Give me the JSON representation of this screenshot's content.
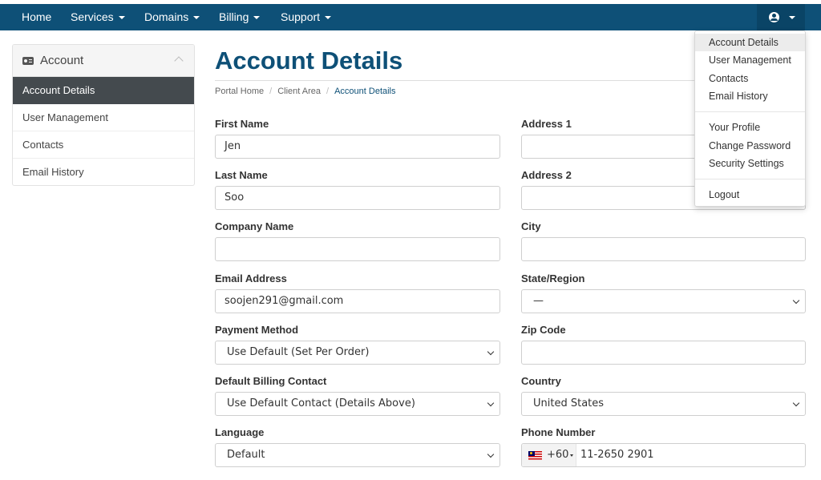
{
  "nav": {
    "home": "Home",
    "services": "Services",
    "domains": "Domains",
    "billing": "Billing",
    "support": "Support"
  },
  "sidebar": {
    "title": "Account",
    "items": [
      {
        "label": "Account Details"
      },
      {
        "label": "User Management"
      },
      {
        "label": "Contacts"
      },
      {
        "label": "Email History"
      }
    ]
  },
  "main": {
    "title": "Account Details",
    "breadcrumb": [
      "Portal Home",
      "Client Area",
      "Account Details"
    ]
  },
  "form": {
    "first_name": {
      "label": "First Name",
      "value": "Jen"
    },
    "last_name": {
      "label": "Last Name",
      "value": "Soo"
    },
    "company_name": {
      "label": "Company Name",
      "value": ""
    },
    "email": {
      "label": "Email Address",
      "value": "soojen291@gmail.com"
    },
    "payment_method": {
      "label": "Payment Method",
      "value": "Use Default (Set Per Order)"
    },
    "billing_contact": {
      "label": "Default Billing Contact",
      "value": "Use Default Contact (Details Above)"
    },
    "language": {
      "label": "Language",
      "value": "Default"
    },
    "address1": {
      "label": "Address 1",
      "value": ""
    },
    "address2": {
      "label": "Address 2",
      "value": ""
    },
    "city": {
      "label": "City",
      "value": ""
    },
    "state": {
      "label": "State/Region",
      "value": "—"
    },
    "zip": {
      "label": "Zip Code",
      "value": ""
    },
    "country": {
      "label": "Country",
      "value": "United States"
    },
    "phone": {
      "label": "Phone Number",
      "dial_code": "+60",
      "value": "11-2650 2901"
    }
  },
  "user_menu": {
    "items": [
      "Account Details",
      "User Management",
      "Contacts",
      "Email History"
    ],
    "profile_items": [
      "Your Profile",
      "Change Password",
      "Security Settings"
    ],
    "logout": "Logout"
  },
  "colors": {
    "navbar": "#0e5077",
    "accent": "#0e5077",
    "sidebar_active": "#444a4e"
  }
}
